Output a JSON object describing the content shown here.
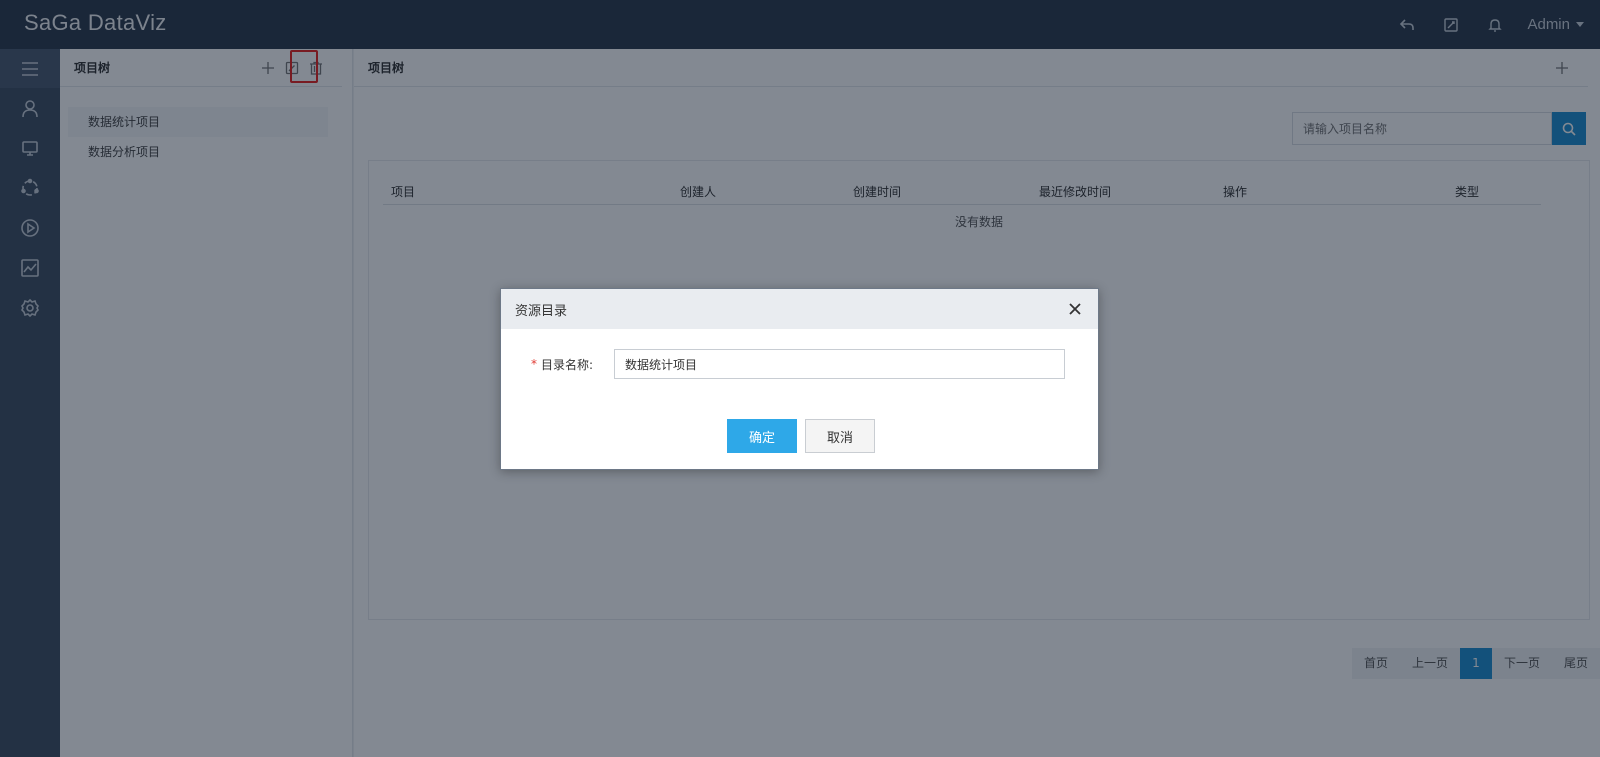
{
  "app": {
    "logo_text": "SaGa DataViz"
  },
  "topbar": {
    "icons": [
      "undo-icon",
      "edit-icon",
      "bell-icon"
    ],
    "user": "Admin"
  },
  "leftnav": {
    "items": [
      "menu-icon",
      "user-icon",
      "monitor-icon",
      "cycle-icon",
      "play-icon",
      "chart-icon",
      "gear-icon"
    ]
  },
  "tree_panel": {
    "title": "项目树",
    "items": [
      "数据统计项目",
      "数据分析项目"
    ]
  },
  "main": {
    "title": "项目树",
    "search_placeholder": "请输入项目名称",
    "columns": [
      "项目",
      "创建人",
      "创建时间",
      "最近修改时间",
      "操作",
      "类型"
    ],
    "empty_text": "没有数据",
    "pager": {
      "first": "首页",
      "prev": "上一页",
      "current": "1",
      "next": "下一页",
      "last": "尾页"
    }
  },
  "dialog": {
    "title": "资源目录",
    "required_mark": "*",
    "label": "目录名称:",
    "value": "数据统计项目",
    "ok": "确定",
    "cancel": "取消"
  },
  "colors": {
    "topbar": "#2c3a4d",
    "accent": "#1f8fd0",
    "ok_button": "#2ea8e8",
    "highlight": "#e8231f"
  }
}
